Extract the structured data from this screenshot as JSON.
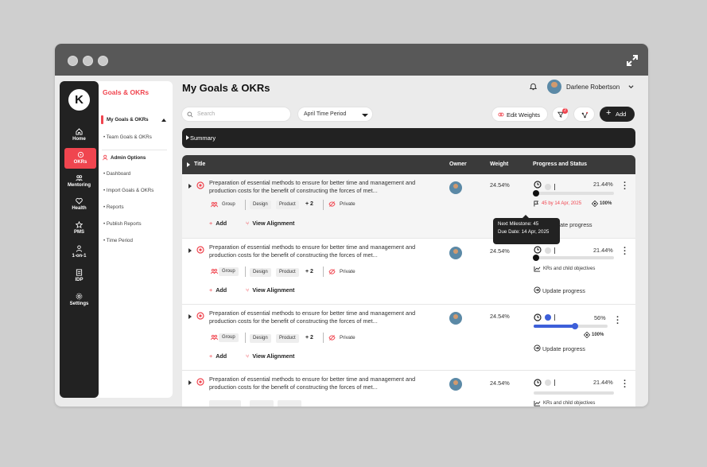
{
  "app": {
    "title": "My Goals & OKRs",
    "user": "Darlene Robertson"
  },
  "rail": {
    "items": [
      {
        "label": "Home",
        "icon": "home-icon"
      },
      {
        "label": "OKRs",
        "icon": "okr-icon"
      },
      {
        "label": "Mentoring",
        "icon": "mentoring-icon"
      },
      {
        "label": "Health",
        "icon": "health-icon"
      },
      {
        "label": "PMS",
        "icon": "pms-icon"
      },
      {
        "label": "1-on-1",
        "icon": "one-on-one-icon"
      },
      {
        "label": "IDP",
        "icon": "idp-icon"
      },
      {
        "label": "Settings",
        "icon": "settings-icon"
      }
    ]
  },
  "submenu": {
    "title": "Goals & OKRs",
    "my": "My Goals & OKRs",
    "team": "• Team Goals & OKRs",
    "admin": "Admin Options",
    "items": [
      "• Dashboard",
      "• Import Goals & OKRs",
      "• Reports",
      "• Publish Reports",
      "• Time Period"
    ]
  },
  "toolbar": {
    "search_placeholder": "Search",
    "period": "April Time Period",
    "edit_weights": "Edit Weights",
    "add": "Add",
    "badge": "2"
  },
  "summary": "Summary",
  "table": {
    "headers": {
      "title": "Title",
      "owner": "Owner",
      "weight": "Weight",
      "progress": "Progress and Status"
    },
    "rows": [
      {
        "title": "Preparation of essential methods to ensure for better time and management and production costs for the benefit of constructing the forces of met...",
        "weight": "24.54%",
        "pct": "21.44%",
        "progress": 0.0,
        "status_color": "#dddddd",
        "tags": [
          "Group",
          "Design",
          "Product"
        ],
        "more": "+ 2",
        "private": "Private",
        "milestone_line": "45 by 14 Apr, 2025",
        "target": "100%"
      },
      {
        "title": "Preparation of essential methods to ensure for better time and management and production costs for the benefit of constructing the forces of met...",
        "weight": "24.54%",
        "pct": "21.44%",
        "progress": 0.0,
        "status_color": "#dddddd",
        "tags": [
          "Group",
          "Design",
          "Product"
        ],
        "more": "+ 2",
        "private": "Private",
        "kr_line": "KRs and child objectives",
        "update": "Update progress"
      },
      {
        "title": "Preparation of essential methods to ensure for better time and management and production costs for the benefit of constructing the forces of met...",
        "weight": "24.54%",
        "pct": "56%",
        "progress": 0.56,
        "status_color": "#3d5fd9",
        "tags": [
          "Group",
          "Design",
          "Product"
        ],
        "more": "+ 2",
        "private": "Private",
        "target": "100%",
        "update": "Update progress"
      },
      {
        "title": "Preparation of essential methods to ensure for better time and management and production costs for the benefit of constructing the forces of met...",
        "weight": "24.54%",
        "pct": "21.44%",
        "progress": 0.0,
        "status_color": "#dddddd",
        "kr_line": "KRs and child objectives"
      }
    ],
    "actions": {
      "add": "Add",
      "align": "View Alignment"
    }
  },
  "tooltip": {
    "line1": "Next Milestone: 45",
    "line2": "Due Date: 14 Apr, 2025"
  },
  "row1_update_partial": "ate progress",
  "colors": {
    "accent": "#f0454f",
    "blue": "#3d5fd9",
    "dark": "#222222"
  }
}
